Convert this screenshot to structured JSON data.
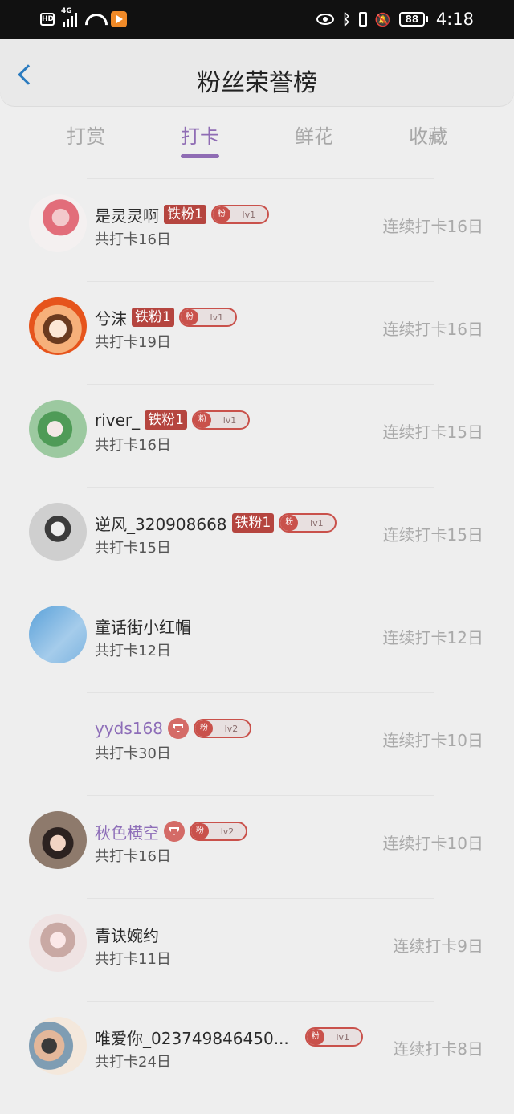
{
  "status_bar": {
    "hd": "HD",
    "network": "4G",
    "battery": "88",
    "time": "4:18"
  },
  "header": {
    "title": "粉丝荣誉榜"
  },
  "tabs": [
    {
      "label": "打赏"
    },
    {
      "label": "打卡"
    },
    {
      "label": "鲜花"
    },
    {
      "label": "收藏"
    }
  ],
  "active_tab": "打卡",
  "fan_label": "粉",
  "rows": [
    {
      "name": "是灵灵啊",
      "iron": "铁粉1",
      "level": "lv1",
      "total": "共打卡16日",
      "streak": "连续打卡16日",
      "avatar": "pink"
    },
    {
      "name": "兮沫",
      "iron": "铁粉1",
      "level": "lv1",
      "total": "共打卡19日",
      "streak": "连续打卡16日",
      "avatar": "girl"
    },
    {
      "name": "river_",
      "iron": "铁粉1",
      "level": "lv1",
      "total": "共打卡16日",
      "streak": "连续打卡15日",
      "avatar": "green"
    },
    {
      "name": "逆风_320908668",
      "iron": "铁粉1",
      "level": "lv1",
      "total": "共打卡15日",
      "streak": "连续打卡15日",
      "avatar": "photo"
    },
    {
      "name": "童话街小红帽",
      "total": "共打卡12日",
      "streak": "连续打卡12日",
      "avatar": "blue"
    },
    {
      "name": "yyds168",
      "level": "lv2",
      "total": "共打卡30日",
      "streak": "连续打卡10日",
      "avatar": "empty",
      "vip": true
    },
    {
      "name": "秋色横空",
      "level": "lv2",
      "total": "共打卡16日",
      "streak": "连续打卡10日",
      "avatar": "autumn",
      "vip": true
    },
    {
      "name": "青诀婉约",
      "total": "共打卡11日",
      "streak": "连续打卡9日",
      "avatar": "lady"
    },
    {
      "name": "唯爱你_023749846450...",
      "level": "lv1",
      "total": "共打卡24日",
      "streak": "连续打卡8日",
      "avatar": "couple"
    }
  ]
}
